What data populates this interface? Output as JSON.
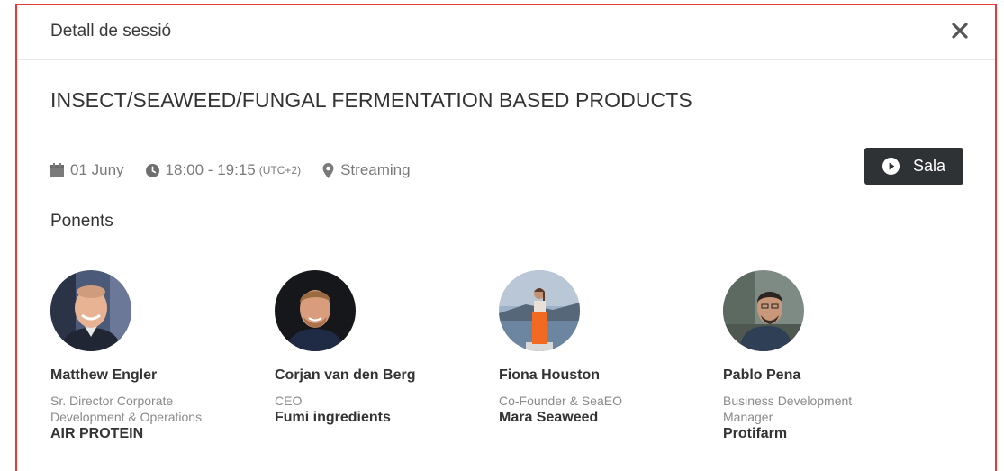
{
  "modal": {
    "title": "Detall de sessió"
  },
  "session": {
    "title": "INSECT/SEAWEED/FUNGAL FERMENTATION BASED PRODUCTS",
    "date": "01 Juny",
    "time": "18:00 - 19:15",
    "timezone": "(UTC+2)",
    "location": "Streaming",
    "room_button_label": "Sala"
  },
  "speakers_section": {
    "title": "Ponents",
    "speakers": [
      {
        "name": "Matthew Engler",
        "role": "Sr. Director Corporate Development & Operations",
        "company": "AIR PROTEIN"
      },
      {
        "name": "Corjan van den Berg",
        "role": "CEO",
        "company": "Fumi ingredients"
      },
      {
        "name": "Fiona Houston",
        "role": "Co-Founder & SeaEO",
        "company": "Mara Seaweed"
      },
      {
        "name": "Pablo Pena",
        "role": "Business Development Manager",
        "company": "Protifarm"
      }
    ]
  },
  "icons": {
    "close": "close-icon",
    "date": "calendar-icon",
    "time": "clock-icon",
    "location": "map-marker-icon",
    "room_button": "play-circle-icon"
  },
  "colors": {
    "frame_border": "#e53935",
    "button_background": "#2f3235",
    "muted_text": "#7a7a7a"
  }
}
